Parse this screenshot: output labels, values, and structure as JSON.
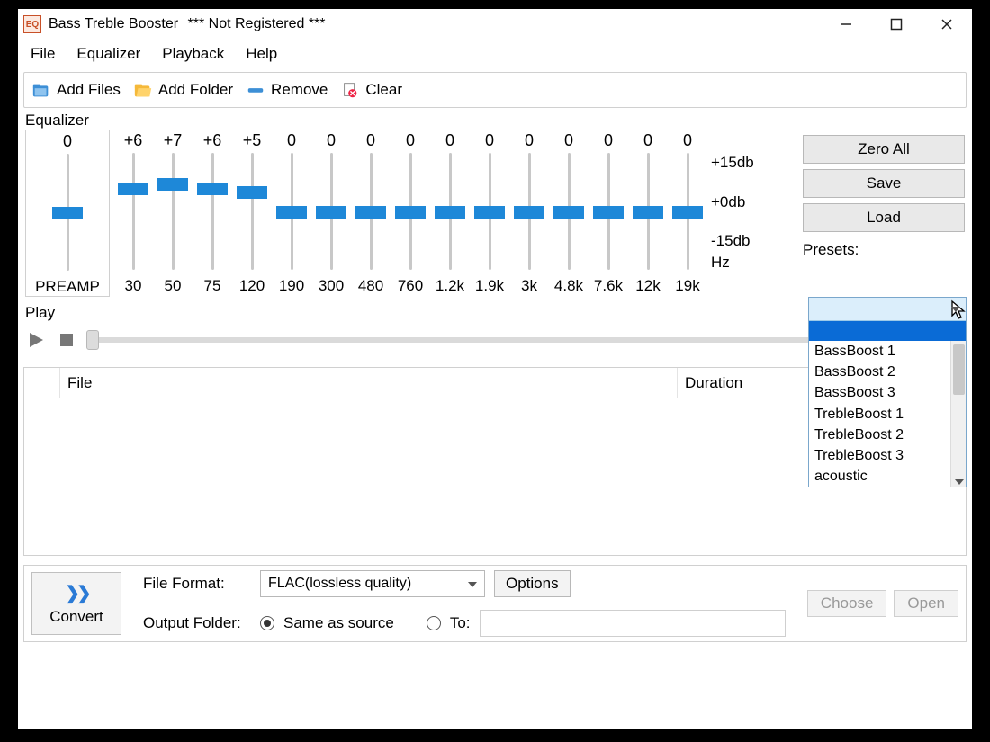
{
  "window": {
    "icon_text": "EQ",
    "title": "Bass Treble Booster",
    "registration": "*** Not Registered ***"
  },
  "menu": {
    "file": "File",
    "equalizer": "Equalizer",
    "playback": "Playback",
    "help": "Help"
  },
  "toolbar": {
    "add_files": "Add Files",
    "add_folder": "Add Folder",
    "remove": "Remove",
    "clear": "Clear"
  },
  "equalizer": {
    "section_label": "Equalizer",
    "preamp_label": "PREAMP",
    "preamp_value": "0",
    "hz_label": "Hz",
    "scale": {
      "top": "+15db",
      "mid": "+0db",
      "bot": "-15db"
    },
    "bands": [
      {
        "label": "30",
        "value": "+6"
      },
      {
        "label": "50",
        "value": "+7"
      },
      {
        "label": "75",
        "value": "+6"
      },
      {
        "label": "120",
        "value": "+5"
      },
      {
        "label": "190",
        "value": "0"
      },
      {
        "label": "300",
        "value": "0"
      },
      {
        "label": "480",
        "value": "0"
      },
      {
        "label": "760",
        "value": "0"
      },
      {
        "label": "1.2k",
        "value": "0"
      },
      {
        "label": "1.9k",
        "value": "0"
      },
      {
        "label": "3k",
        "value": "0"
      },
      {
        "label": "4.8k",
        "value": "0"
      },
      {
        "label": "7.6k",
        "value": "0"
      },
      {
        "label": "12k",
        "value": "0"
      },
      {
        "label": "19k",
        "value": "0"
      }
    ],
    "buttons": {
      "zero_all": "Zero All",
      "save": "Save",
      "load": "Load"
    },
    "presets_label": "Presets:",
    "preset_options": {
      "o0": "BassBoost 1",
      "o1": "BassBoost 2",
      "o2": "BassBoost 3",
      "o3": "TrebleBoost 1",
      "o4": "TrebleBoost 2",
      "o5": "TrebleBoost 3",
      "o6": "acoustic"
    }
  },
  "play": {
    "section_label": "Play"
  },
  "filelist": {
    "col_file": "File",
    "col_duration": "Duration"
  },
  "bottom": {
    "convert": "Convert",
    "file_format_label": "File Format:",
    "file_format_value": "FLAC(lossless quality)",
    "options": "Options",
    "output_folder_label": "Output Folder:",
    "same_as_source": "Same as source",
    "to": "To:",
    "choose": "Choose",
    "open": "Open"
  }
}
